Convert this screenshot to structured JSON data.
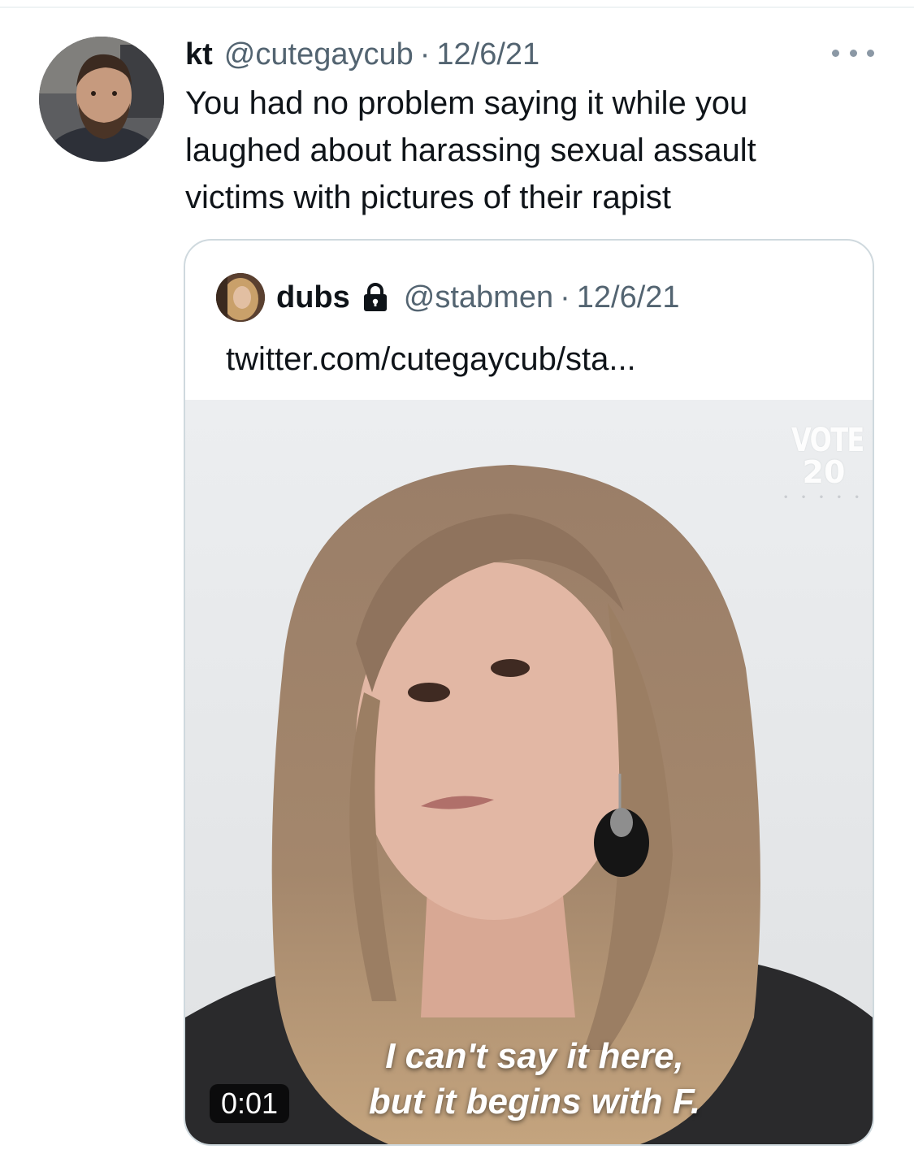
{
  "tweet": {
    "author_name": "kt",
    "author_handle": "@cutegaycub",
    "separator": "·",
    "date": "12/6/21",
    "text": "You had no problem saying it while you laughed about harassing sexual assault victims with pictures of their rapist"
  },
  "quoted_tweet": {
    "author_name": "dubs",
    "protected_icon": "lock-icon",
    "author_handle": "@stabmen",
    "separator": "·",
    "date": "12/6/21",
    "text": "twitter.com/cutegaycub/sta...",
    "video": {
      "caption_line1": "I can't say it here,",
      "caption_line2": "but it begins with F.",
      "timestamp": "0:01",
      "logo_word": "VOTE",
      "logo_number": "20",
      "logo_dots": "• • • • •"
    }
  },
  "icons": {
    "more": "more-horizontal-icon"
  },
  "colors": {
    "text_primary": "#0f1419",
    "text_secondary": "#536471",
    "border": "#cfd9de"
  }
}
